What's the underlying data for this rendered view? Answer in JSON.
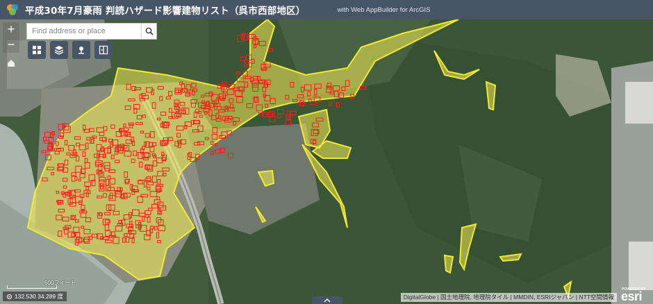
{
  "header": {
    "title": "平成30年7月豪雨 判読ハザード影響建物リスト（呉市西部地区）",
    "subtitle": "with Web AppBuilder for ArcGIS"
  },
  "search": {
    "placeholder": "Find address or place"
  },
  "zoom": {
    "in": "+",
    "out": "−"
  },
  "widgets": [
    "basemap-gallery-icon",
    "layer-list-icon",
    "legend-icon",
    "split-view-icon"
  ],
  "scalebar": {
    "label": "600フィート"
  },
  "coordinates": {
    "text": "132.530 34.289 度"
  },
  "attribution": {
    "text": "DigitalGlobe | 国土地理院, 地理院タイル | MMDIN, ESRIジャパン | NTT空間情報"
  },
  "esri": {
    "powered_by": "POWERED BY",
    "brand": "esri"
  },
  "colors": {
    "header": "#485566",
    "hazard_fill": "#f4ee52",
    "building_outline": "#ff0000",
    "forest": "#3f5a3a",
    "sea": "#a7b3ad"
  }
}
